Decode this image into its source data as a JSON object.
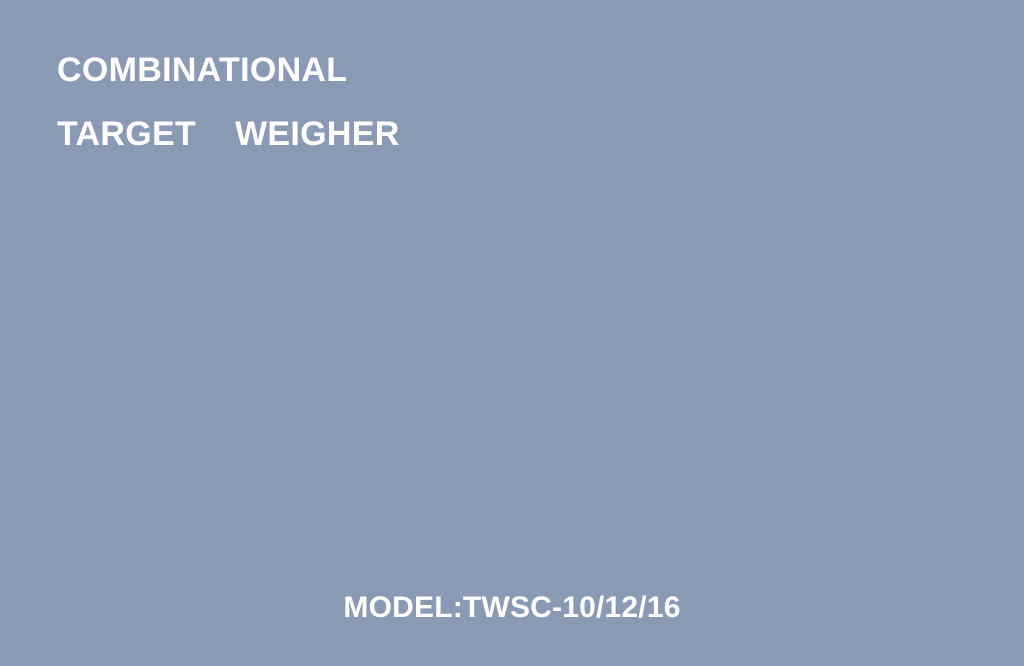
{
  "background_color": "#8a9ab4",
  "text_color": "#ffffff",
  "title": {
    "line1": "COMBINATIONAL",
    "line2": "TARGET    WEIGHER"
  },
  "model_label": "MODEL:TWSC-10/12/16"
}
